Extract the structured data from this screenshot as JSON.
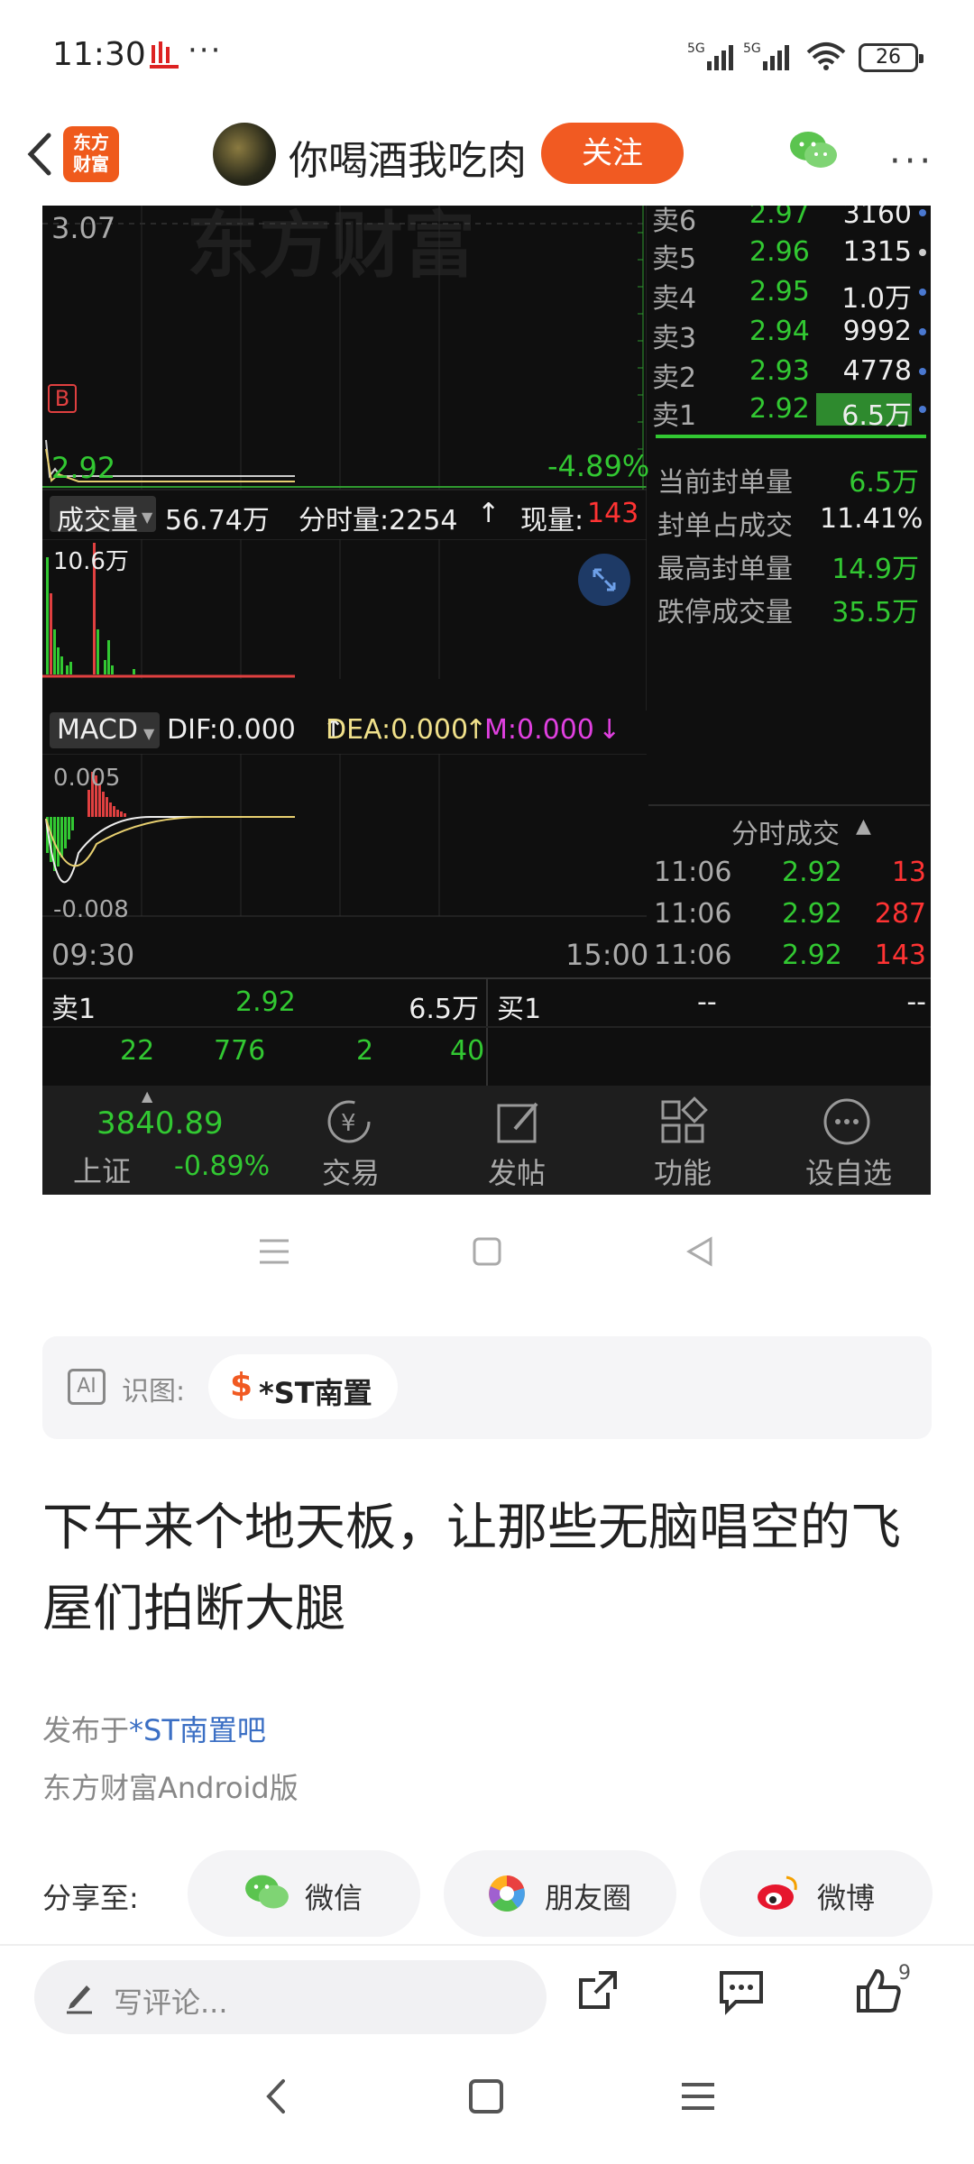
{
  "status_bar": {
    "time": "11:30",
    "dots": "···",
    "battery": "26",
    "signal_1": "5G",
    "signal_2": "5G"
  },
  "nav": {
    "brand_line1": "东方",
    "brand_line2": "财富",
    "author": "你喝酒我吃肉",
    "follow": "关注"
  },
  "stock": {
    "watermark": "东方财富",
    "price_top": "3.07",
    "price_bottom": "2.92",
    "pct": "-4.89%",
    "sell_levels": [
      {
        "label": "卖6",
        "price": "2.97",
        "qty": "3160"
      },
      {
        "label": "卖5",
        "price": "2.96",
        "qty": "1315"
      },
      {
        "label": "卖4",
        "price": "2.95",
        "qty": "1.0万"
      },
      {
        "label": "卖3",
        "price": "2.94",
        "qty": "9992"
      },
      {
        "label": "卖2",
        "price": "2.93",
        "qty": "4778"
      },
      {
        "label": "卖1",
        "price": "2.92",
        "qty": "6.5万"
      }
    ],
    "seal_stats": [
      {
        "label": "当前封单量",
        "value": "6.5万"
      },
      {
        "label": "封单占成交",
        "value": "11.41%"
      },
      {
        "label": "最高封单量",
        "value": "14.9万"
      },
      {
        "label": "跌停成交量",
        "value": "35.5万"
      }
    ],
    "volume_bar": {
      "label": "成交量",
      "total": "56.74万",
      "tick_label": "分时量:2254",
      "current_label": "现量:",
      "current_value": "143"
    },
    "vol_max": "10.6万",
    "macd": {
      "label": "MACD",
      "dif": "DIF:0.000",
      "dea": "DEA:0.000",
      "m": "M:0.000",
      "top": "0.005",
      "bottom": "-0.008"
    },
    "time_start": "09:30",
    "time_end": "15:00",
    "ticks_title": "分时成交",
    "ticks": [
      {
        "time": "11:06",
        "price": "2.92",
        "vol": "13"
      },
      {
        "time": "11:06",
        "price": "2.92",
        "vol": "287"
      },
      {
        "time": "11:06",
        "price": "2.92",
        "vol": "143"
      }
    ],
    "bottom_sell_label": "卖1",
    "bottom_sell_price": "2.92",
    "bottom_sell_qty": "6.5万",
    "bottom_buy_label": "买1",
    "bottom_buy_price": "--",
    "bottom_buy_qty": "--",
    "bottom_row": [
      "22",
      "776",
      "2",
      "40"
    ],
    "index_value": "3840.89",
    "index_name": "上证",
    "index_pct": "-0.89%",
    "tabs": [
      "交易",
      "发帖",
      "功能",
      "设自选"
    ]
  },
  "tag_box": {
    "ai": "AI",
    "label": "识图:",
    "dollar": "$",
    "stock_name": "*ST南置"
  },
  "post": {
    "title": "下午来个地天板，让那些无脑唱空的飞屋们拍断大腿",
    "posted_prefix": "发布于",
    "posted_forum": "*ST南置吧",
    "client": "东方财富Android版"
  },
  "share": {
    "label": "分享至:",
    "wechat": "微信",
    "moments": "朋友圈",
    "weibo": "微博"
  },
  "comment": {
    "placeholder": "写评论...",
    "likes": "9"
  }
}
